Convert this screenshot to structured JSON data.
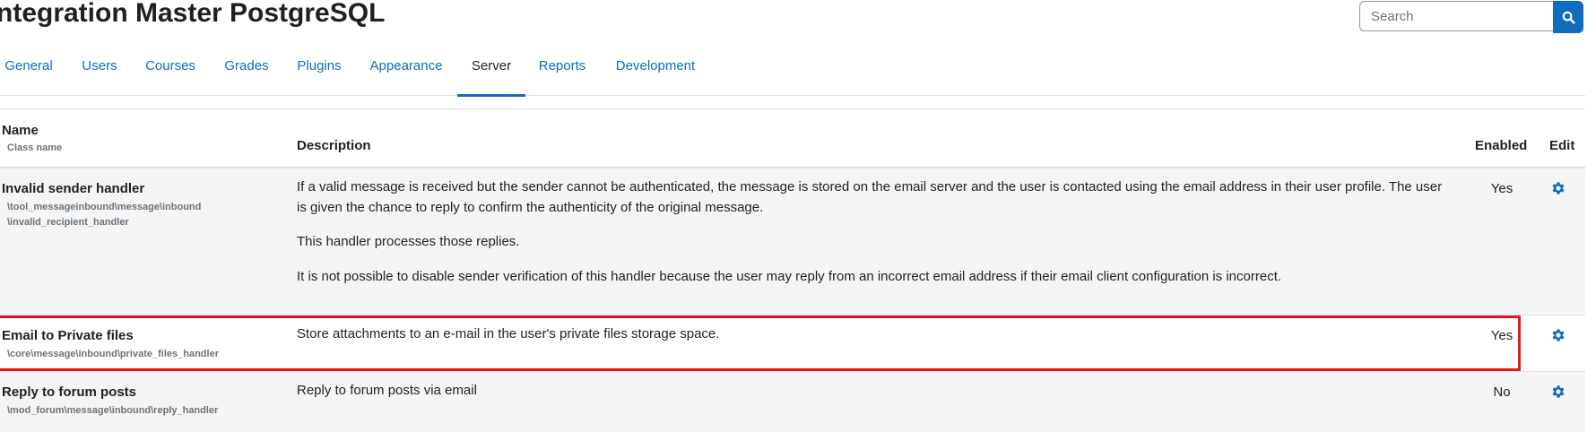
{
  "header": {
    "title": "ntegration Master PostgreSQL"
  },
  "search": {
    "placeholder": "Search",
    "icon": "search-icon"
  },
  "tabs": [
    {
      "label": "General"
    },
    {
      "label": "Users"
    },
    {
      "label": "Courses"
    },
    {
      "label": "Grades"
    },
    {
      "label": "Plugins"
    },
    {
      "label": "Appearance"
    },
    {
      "label": "Server",
      "active": true
    },
    {
      "label": "Reports"
    },
    {
      "label": "Development"
    }
  ],
  "table": {
    "headers": {
      "name": "Name",
      "class_name": "Class name",
      "description": "Description",
      "enabled": "Enabled",
      "edit": "Edit"
    },
    "rows": [
      {
        "name": "Invalid sender handler",
        "class_name_line1": "\\tool_messageinbound\\message\\inbound",
        "class_name_line2": "\\invalid_recipient_handler",
        "desc_p1": "If a valid message is received but the sender cannot be authenticated, the message is stored on the email server and the user is contacted using the email address in their user profile. The user is given the chance to reply to confirm the authenticity of the original message.",
        "desc_p2": "This handler processes those replies.",
        "desc_p3": "It is not possible to disable sender verification of this handler because the user may reply from an incorrect email address if their email client configuration is incorrect.",
        "enabled": "Yes",
        "edit_icon": "gear-icon"
      },
      {
        "name": "Email to Private files",
        "class_name_line1": "\\core\\message\\inbound\\private_files_handler",
        "desc_p1": "Store attachments to an e-mail in the user's private files storage space.",
        "enabled": "Yes",
        "edit_icon": "gear-icon",
        "highlighted": true
      },
      {
        "name": "Reply to forum posts",
        "class_name_line1": "\\mod_forum\\message\\inbound\\reply_handler",
        "desc_p1": "Reply to forum posts via email",
        "enabled": "No",
        "edit_icon": "gear-icon"
      }
    ]
  },
  "colors": {
    "accent": "#0f6cbf",
    "highlight_border": "#e8141c",
    "stripe": "#f5f5f5"
  }
}
